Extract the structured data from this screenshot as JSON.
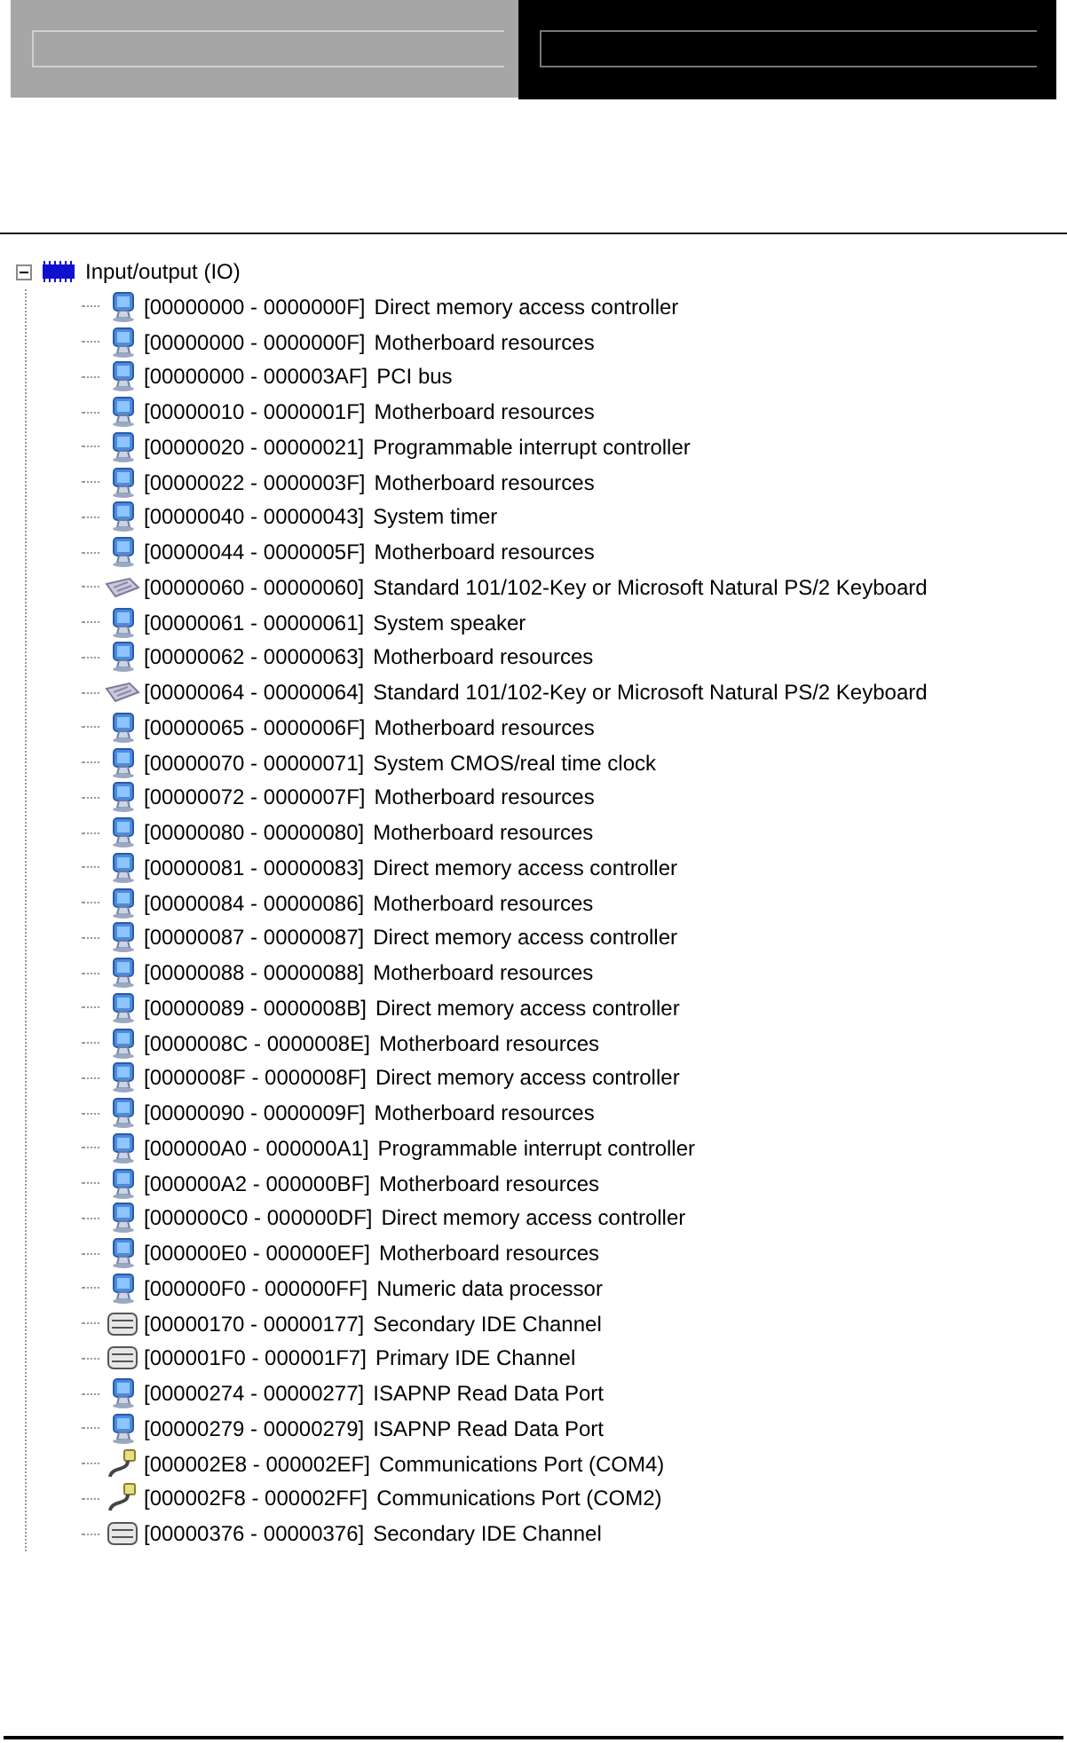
{
  "tree": {
    "label": "Input/output (IO)",
    "expanded": true,
    "children": [
      {
        "range": "[00000000 - 0000000F]",
        "name": "Direct memory access controller",
        "kind": "system"
      },
      {
        "range": "[00000000 - 0000000F]",
        "name": "Motherboard resources",
        "kind": "system"
      },
      {
        "range": "[00000000 - 000003AF]",
        "name": "PCI bus",
        "kind": "system"
      },
      {
        "range": "[00000010 - 0000001F]",
        "name": "Motherboard resources",
        "kind": "system"
      },
      {
        "range": "[00000020 - 00000021]",
        "name": "Programmable interrupt controller",
        "kind": "system"
      },
      {
        "range": "[00000022 - 0000003F]",
        "name": "Motherboard resources",
        "kind": "system"
      },
      {
        "range": "[00000040 - 00000043]",
        "name": "System timer",
        "kind": "system"
      },
      {
        "range": "[00000044 - 0000005F]",
        "name": "Motherboard resources",
        "kind": "system"
      },
      {
        "range": "[00000060 - 00000060]",
        "name": "Standard 101/102-Key or Microsoft Natural PS/2 Keyboard",
        "kind": "keyboard"
      },
      {
        "range": "[00000061 - 00000061]",
        "name": "System speaker",
        "kind": "system"
      },
      {
        "range": "[00000062 - 00000063]",
        "name": "Motherboard resources",
        "kind": "system"
      },
      {
        "range": "[00000064 - 00000064]",
        "name": "Standard 101/102-Key or Microsoft Natural PS/2 Keyboard",
        "kind": "keyboard"
      },
      {
        "range": "[00000065 - 0000006F]",
        "name": "Motherboard resources",
        "kind": "system"
      },
      {
        "range": "[00000070 - 00000071]",
        "name": "System CMOS/real time clock",
        "kind": "system"
      },
      {
        "range": "[00000072 - 0000007F]",
        "name": "Motherboard resources",
        "kind": "system"
      },
      {
        "range": "[00000080 - 00000080]",
        "name": "Motherboard resources",
        "kind": "system"
      },
      {
        "range": "[00000081 - 00000083]",
        "name": "Direct memory access controller",
        "kind": "system"
      },
      {
        "range": "[00000084 - 00000086]",
        "name": "Motherboard resources",
        "kind": "system"
      },
      {
        "range": "[00000087 - 00000087]",
        "name": "Direct memory access controller",
        "kind": "system"
      },
      {
        "range": "[00000088 - 00000088]",
        "name": "Motherboard resources",
        "kind": "system"
      },
      {
        "range": "[00000089 - 0000008B]",
        "name": "Direct memory access controller",
        "kind": "system"
      },
      {
        "range": "[0000008C - 0000008E]",
        "name": "Motherboard resources",
        "kind": "system"
      },
      {
        "range": "[0000008F - 0000008F]",
        "name": "Direct memory access controller",
        "kind": "system"
      },
      {
        "range": "[00000090 - 0000009F]",
        "name": "Motherboard resources",
        "kind": "system"
      },
      {
        "range": "[000000A0 - 000000A1]",
        "name": "Programmable interrupt controller",
        "kind": "system"
      },
      {
        "range": "[000000A2 - 000000BF]",
        "name": "Motherboard resources",
        "kind": "system"
      },
      {
        "range": "[000000C0 - 000000DF]",
        "name": "Direct memory access controller",
        "kind": "system"
      },
      {
        "range": "[000000E0 - 000000EF]",
        "name": "Motherboard resources",
        "kind": "system"
      },
      {
        "range": "[000000F0 - 000000FF]",
        "name": "Numeric data processor",
        "kind": "system"
      },
      {
        "range": "[00000170 - 00000177]",
        "name": "Secondary IDE Channel",
        "kind": "ide"
      },
      {
        "range": "[000001F0 - 000001F7]",
        "name": "Primary IDE Channel",
        "kind": "ide"
      },
      {
        "range": "[00000274 - 00000277]",
        "name": "ISAPNP Read Data Port",
        "kind": "system"
      },
      {
        "range": "[00000279 - 00000279]",
        "name": "ISAPNP Read Data Port",
        "kind": "system"
      },
      {
        "range": "[000002E8 - 000002EF]",
        "name": "Communications Port (COM4)",
        "kind": "port"
      },
      {
        "range": "[000002F8 - 000002FF]",
        "name": "Communications Port (COM2)",
        "kind": "port"
      },
      {
        "range": "[00000376 - 00000376]",
        "name": "Secondary IDE Channel",
        "kind": "ide"
      }
    ]
  }
}
